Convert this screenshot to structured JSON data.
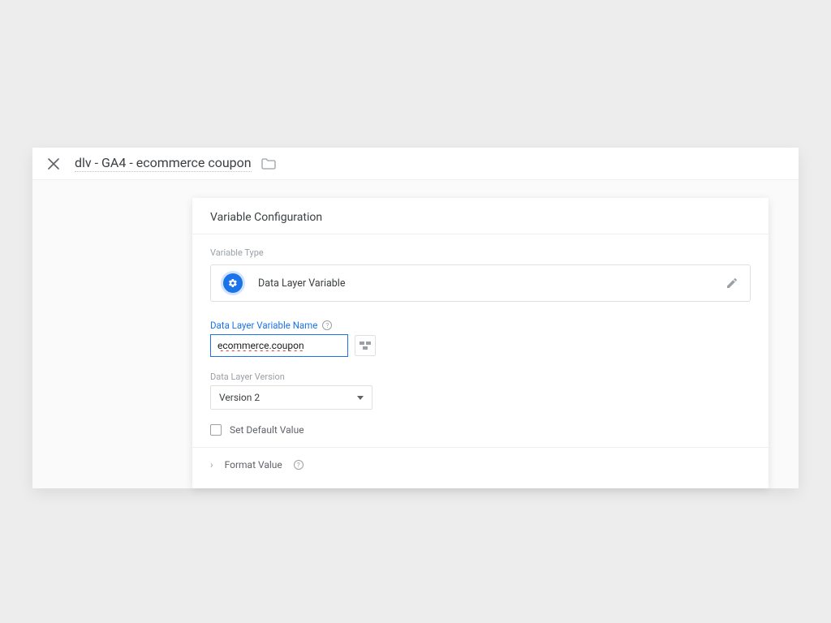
{
  "header": {
    "title": "dlv - GA4 - ecommerce coupon"
  },
  "card": {
    "title": "Variable Configuration",
    "variable_type_label": "Variable Type",
    "variable_type_value": "Data Layer Variable",
    "name_field_label": "Data Layer Variable Name",
    "name_field_value": "ecommerce.coupon",
    "version_label": "Data Layer Version",
    "version_value": "Version 2",
    "default_checkbox_label": "Set Default Value",
    "format_value_label": "Format Value"
  }
}
